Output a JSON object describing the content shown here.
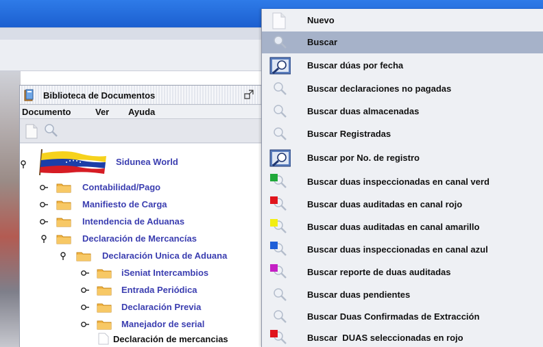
{
  "doc_window": {
    "title": "Biblioteca de Documentos",
    "menus": [
      "Documento",
      "Ver",
      "Ayuda"
    ],
    "tree": {
      "root": "Sidunea World",
      "items": [
        {
          "label": "Contabilidad/Pago",
          "level": 1,
          "expanded": false
        },
        {
          "label": "Manifiesto de Carga",
          "level": 1,
          "expanded": false
        },
        {
          "label": "Intendencia de Aduanas",
          "level": 1,
          "expanded": false
        },
        {
          "label": "Declaración de Mercancías",
          "level": 1,
          "expanded": true
        },
        {
          "label": "Declaración Unica de Aduana",
          "level": 2,
          "expanded": true
        },
        {
          "label": "iSeniat Intercambios",
          "level": 3,
          "expanded": false
        },
        {
          "label": "Entrada Periódica",
          "level": 3,
          "expanded": false
        },
        {
          "label": "Declaración Previa",
          "level": 3,
          "expanded": false
        },
        {
          "label": "Manejador de serial",
          "level": 3,
          "expanded": false
        },
        {
          "label": "Declaración de mercancias",
          "level": 4,
          "leaf": true
        }
      ]
    }
  },
  "popup_menu": {
    "items": [
      {
        "label": "Nuevo",
        "icon": "new-document-icon"
      },
      {
        "label": "Buscar",
        "icon": "search-icon",
        "highlighted": true
      },
      {
        "label": "Buscar dúas por fecha",
        "icon": "search-by-date-icon"
      },
      {
        "label": "Buscar declaraciones no pagadas",
        "icon": "search-icon"
      },
      {
        "label": "Buscar duas almacenadas",
        "icon": "search-icon"
      },
      {
        "label": "Buscar Registradas",
        "icon": "search-icon"
      },
      {
        "label": "Buscar por No. de registro",
        "icon": "search-by-number-icon"
      },
      {
        "label": "Buscar duas inspeccionadas en canal verd",
        "icon": "search-green-icon",
        "color": "#1fa83a"
      },
      {
        "label": "Buscar duas auditadas en canal rojo",
        "icon": "search-red-icon",
        "color": "#e0141c"
      },
      {
        "label": "Buscar duas auditadas en canal amarillo",
        "icon": "search-yellow-icon",
        "color": "#f2ee12"
      },
      {
        "label": "Buscar duas inspeccionadas en canal azul",
        "icon": "search-blue-icon",
        "color": "#1f5fd8"
      },
      {
        "label": "Buscar reporte de duas auditadas",
        "icon": "search-magenta-icon",
        "color": "#c41fc4"
      },
      {
        "label": "Buscar duas pendientes",
        "icon": "search-icon"
      },
      {
        "label": "Buscar Duas Confirmadas de Extracción",
        "icon": "search-icon"
      },
      {
        "label": "Buscar  DUAS seleccionadas en rojo",
        "icon": "search-red-icon",
        "color": "#e0141c"
      }
    ]
  }
}
